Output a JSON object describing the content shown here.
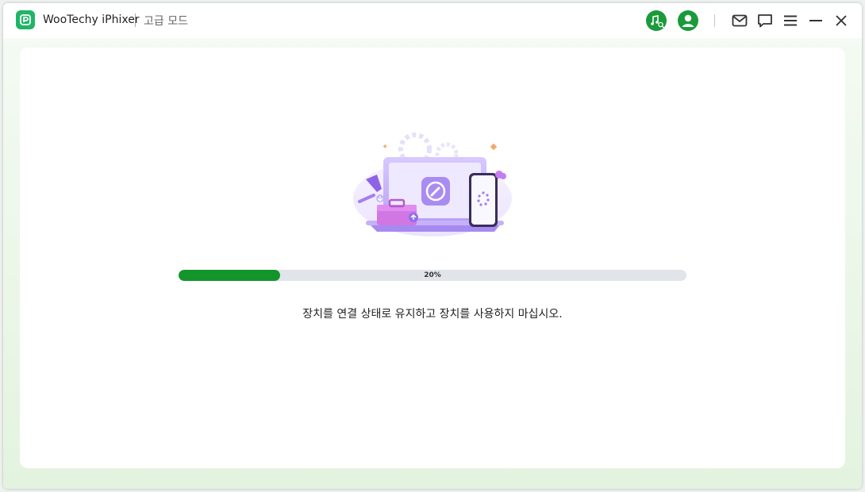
{
  "titlebar": {
    "app_name": "WooTechy iPhixer",
    "mode": "고급 모드",
    "icons": [
      "music-search-icon",
      "user-account-icon",
      "mail-icon",
      "feedback-icon",
      "menu-icon",
      "minimize-icon",
      "close-icon"
    ]
  },
  "progress": {
    "value": 0.2,
    "label": "20%"
  },
  "status_message": "장치를 연결 상태로 유지하고 장치를 사용하지 마십시오.",
  "colors": {
    "brand": "#1fb567",
    "progress_fill": "#13952c",
    "progress_track": "#e1e5e9",
    "accent_purple": "#9a7cf0"
  }
}
